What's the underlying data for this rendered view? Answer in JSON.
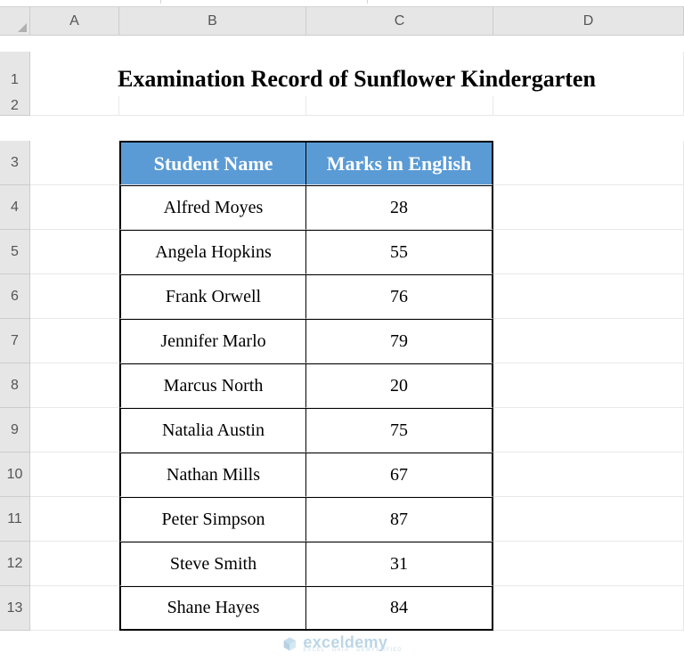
{
  "columns": [
    "A",
    "B",
    "C",
    "D"
  ],
  "rows": [
    "1",
    "2",
    "3",
    "4",
    "5",
    "6",
    "7",
    "8",
    "9",
    "10",
    "11",
    "12",
    "13"
  ],
  "title": "Examination Record of Sunflower Kindergarten",
  "table": {
    "headers": {
      "name": "Student Name",
      "marks": "Marks in English"
    },
    "data": [
      {
        "name": "Alfred Moyes",
        "marks": "28"
      },
      {
        "name": "Angela Hopkins",
        "marks": "55"
      },
      {
        "name": "Frank Orwell",
        "marks": "76"
      },
      {
        "name": "Jennifer Marlo",
        "marks": "79"
      },
      {
        "name": "Marcus North",
        "marks": "20"
      },
      {
        "name": "Natalia Austin",
        "marks": "75"
      },
      {
        "name": "Nathan Mills",
        "marks": "67"
      },
      {
        "name": "Peter Simpson",
        "marks": "87"
      },
      {
        "name": "Steve Smith",
        "marks": "31"
      },
      {
        "name": "Shane Hayes",
        "marks": "84"
      }
    ]
  },
  "watermark": {
    "main": "exceldemy",
    "sub": "EXCEL · DATA · DEMYSTIFIED"
  }
}
